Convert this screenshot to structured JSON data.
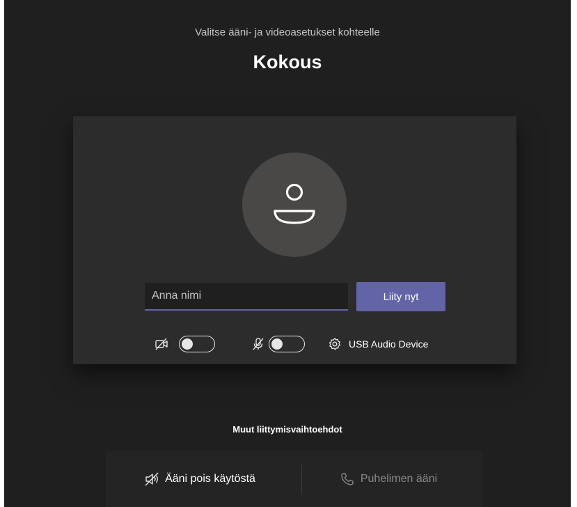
{
  "header": {
    "subtitle": "Valitse ääni- ja videoasetukset kohteelle",
    "title": "Kokous"
  },
  "join": {
    "name_placeholder": "Anna nimi",
    "name_value": "",
    "join_label": "Liity nyt"
  },
  "controls": {
    "camera": {
      "icon": "video-off-icon",
      "enabled": false
    },
    "microphone": {
      "icon": "mic-off-icon",
      "enabled": false
    },
    "device": {
      "icon": "gear-icon",
      "label": "USB Audio Device"
    }
  },
  "other_options": {
    "heading": "Muut liittymisvaihtoehdot",
    "items": [
      {
        "icon": "speaker-off-icon",
        "label": "Ääni pois käytöstä",
        "enabled": true
      },
      {
        "icon": "phone-icon",
        "label": "Puhelimen ääni",
        "enabled": false
      }
    ]
  },
  "colors": {
    "background": "#201f1f",
    "card": "#2d2c2c",
    "accent": "#6264a7",
    "avatar": "#4a4847"
  }
}
